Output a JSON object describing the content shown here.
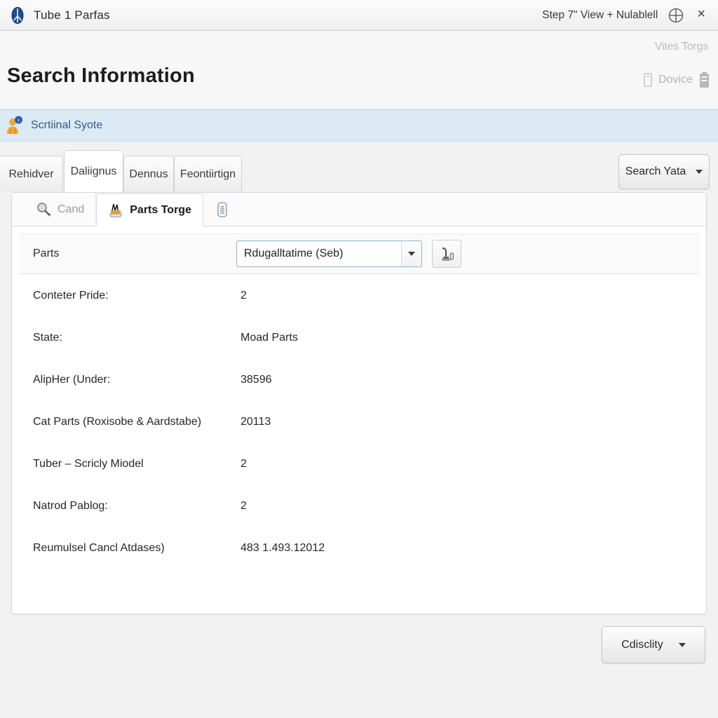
{
  "titlebar": {
    "app_icon": "app-logo-icon",
    "title": "Tube 1 Parfas",
    "step_label": "Step 7\" View  +  Nulablell",
    "plus_icon": "plus-circle-icon",
    "close_label": "×"
  },
  "header": {
    "page_title": "Search Information",
    "right_top_label": "Vites Torgs",
    "device_label": "Dovice",
    "phone_icon": "phone-icon",
    "battery_icon": "battery-icon"
  },
  "infobar": {
    "icon": "user-badge-icon",
    "text": "Scrtiinal Syote"
  },
  "tabs": {
    "items": [
      {
        "label": "Rehidver",
        "active": false
      },
      {
        "label": "Daliignus",
        "active": true
      },
      {
        "label": "Dennus",
        "active": false
      },
      {
        "label": "Feontiirtign",
        "active": false
      }
    ],
    "search_button": "Search Yata"
  },
  "inner_tabs": {
    "items": [
      {
        "label": "Cand",
        "icon": "magnifier-icon",
        "active": false
      },
      {
        "label": "Parts Torge",
        "icon": "parts-icon",
        "active": true
      },
      {
        "label": "",
        "icon": "document-list-icon",
        "active": false
      }
    ]
  },
  "parts_row": {
    "label": "Parts",
    "selected_value": "Rdugalltatime (Seb)",
    "tool_button_icon": "equipment-icon"
  },
  "details": {
    "rows": [
      {
        "label": "Conteter Pride:",
        "value": "2"
      },
      {
        "label": "State:",
        "value": "Moad Parts"
      },
      {
        "label": "AlipHer (Under:",
        "value": "38596"
      },
      {
        "label": "Cat Parts (Roxisobe & Aardstabe)",
        "value": "20113"
      },
      {
        "label": "Tuber – Scricly Miodel",
        "value": "2"
      },
      {
        "label": "Natrod Pablog:",
        "value": "2"
      },
      {
        "label": "Reumulsel Cancl Atdases)",
        "value": "483 1.493.12012"
      }
    ]
  },
  "footer": {
    "dropdown_label": "Cdisclity"
  }
}
